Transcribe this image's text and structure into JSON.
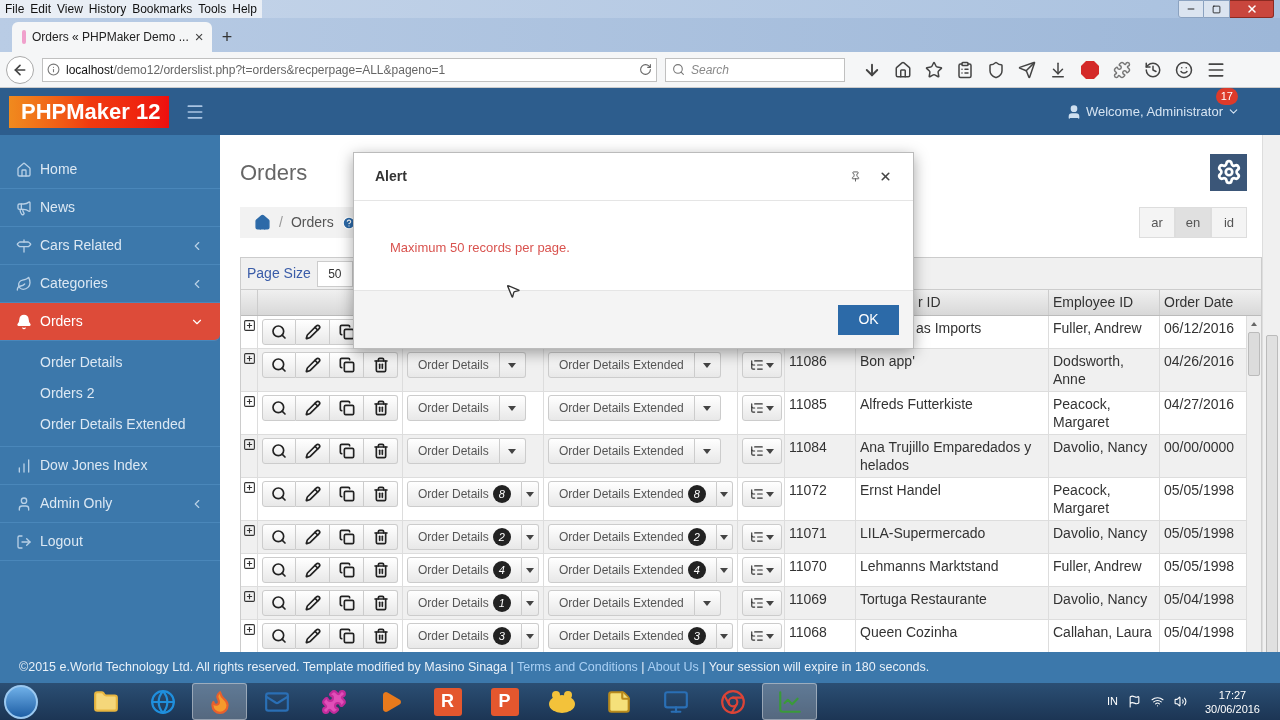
{
  "browser": {
    "menu": [
      "File",
      "Edit",
      "View",
      "History",
      "Bookmarks",
      "Tools",
      "Help"
    ],
    "tab": {
      "title": "Orders « PHPMaker Demo ...",
      "close": "×"
    },
    "new_tab": "+",
    "url": {
      "host": "localhost",
      "path": "/demo12/orderslist.php?t=orders&recperpage=ALL&pageno=1"
    },
    "search": {
      "placeholder": "Search"
    }
  },
  "app": {
    "logo": "PHPMaker 12",
    "user": "Welcome, Administrator",
    "notifications": "17"
  },
  "sidebar": {
    "items": [
      {
        "label": "Home",
        "selected": false
      },
      {
        "label": "News",
        "selected": false
      },
      {
        "label": "Cars Related",
        "selected": false,
        "expanded": false
      },
      {
        "label": "Categories",
        "selected": false,
        "expanded": false
      },
      {
        "label": "Orders",
        "selected": true,
        "expanded": true,
        "children": [
          {
            "label": "Order Details"
          },
          {
            "label": "Orders 2"
          },
          {
            "label": "Order Details Extended"
          }
        ]
      },
      {
        "label": "Dow Jones Index",
        "selected": false
      },
      {
        "label": "Admin Only",
        "selected": false,
        "expanded": false
      },
      {
        "label": "Logout",
        "selected": false
      }
    ]
  },
  "page": {
    "title": "Orders",
    "breadcrumb_separator": "/",
    "breadcrumb": "Orders",
    "languages": [
      {
        "label": "ar",
        "selected": false
      },
      {
        "label": "en",
        "selected": true
      },
      {
        "label": "id",
        "selected": false
      }
    ]
  },
  "table": {
    "page_size_label": "Page Size",
    "page_size": "50",
    "columns": [
      {
        "label": "r ID",
        "covered": true
      },
      {
        "label": "Employee ID",
        "covered": false
      },
      {
        "label": "Order Date",
        "covered": false
      }
    ],
    "rows": [
      {
        "covered": true,
        "customer": "as Imports",
        "employee": "Fuller, Andrew",
        "date": "06/12/2016"
      },
      {
        "covered": false,
        "details": "Order Details",
        "details_extended": "Order Details Extended",
        "order_id": "11086",
        "customer": "Bon app'",
        "employee": "Dodsworth, Anne",
        "date": "04/26/2016"
      },
      {
        "covered": false,
        "details": "Order Details",
        "details_extended": "Order Details Extended",
        "order_id": "11085",
        "customer": "Alfreds Futterkiste",
        "employee": "Peacock, Margaret",
        "date": "04/27/2016"
      },
      {
        "covered": false,
        "details": "Order Details",
        "details_extended": "Order Details Extended",
        "order_id": "11084",
        "customer": "Ana Trujillo Emparedados y helados",
        "employee": "Davolio, Nancy",
        "date": "00/00/0000"
      },
      {
        "covered": false,
        "details": "Order Details",
        "details_count": "8",
        "details_extended": "Order Details Extended",
        "details_extended_count": "8",
        "order_id": "11072",
        "customer": "Ernst Handel",
        "employee": "Peacock, Margaret",
        "date": "05/05/1998"
      },
      {
        "covered": false,
        "details": "Order Details",
        "details_count": "2",
        "details_extended": "Order Details Extended",
        "details_extended_count": "2",
        "order_id": "11071",
        "customer": "LILA-Supermercado",
        "employee": "Davolio, Nancy",
        "date": "05/05/1998"
      },
      {
        "covered": false,
        "details": "Order Details",
        "details_count": "4",
        "details_extended": "Order Details Extended",
        "details_extended_count": "4",
        "order_id": "11070",
        "customer": "Lehmanns Marktstand",
        "employee": "Fuller, Andrew",
        "date": "05/05/1998"
      },
      {
        "covered": false,
        "details": "Order Details",
        "details_count": "1",
        "details_extended": "Order Details Extended",
        "order_id": "11069",
        "customer": "Tortuga Restaurante",
        "employee": "Davolio, Nancy",
        "date": "05/04/1998"
      },
      {
        "covered": false,
        "details": "Order Details",
        "details_count": "3",
        "details_extended": "Order Details Extended",
        "details_extended_count": "3",
        "order_id": "11068",
        "customer": "Queen Cozinha",
        "employee": "Callahan, Laura",
        "date": "05/04/1998"
      }
    ]
  },
  "alert": {
    "title": "Alert",
    "message": "Maximum 50 records per page.",
    "button": "OK"
  },
  "footer": {
    "parts": [
      {
        "kind": "text",
        "text": "©2015 e.World Technology Ltd. All rights reserved. Template modified by Masino Sinaga |"
      },
      {
        "kind": "link",
        "text": "Terms and Conditions"
      },
      {
        "kind": "text",
        "text": "|"
      },
      {
        "kind": "link",
        "text": "About Us"
      },
      {
        "kind": "text",
        "text": "| Your session will expire in 180 seconds."
      }
    ]
  },
  "taskbar": {
    "apps": [
      {
        "kind": "folder",
        "selected": false
      },
      {
        "kind": "ie",
        "selected": false
      },
      {
        "kind": "firefox",
        "selected": true
      },
      {
        "kind": "mail",
        "selected": false
      },
      {
        "kind": "purple",
        "selected": false
      },
      {
        "kind": "media",
        "selected": false
      },
      {
        "kind": "letter",
        "label": "R",
        "selected": false
      },
      {
        "kind": "letter",
        "label": "P",
        "selected": false
      },
      {
        "kind": "creature",
        "selected": false
      },
      {
        "kind": "note",
        "selected": false
      },
      {
        "kind": "remote",
        "selected": false
      },
      {
        "kind": "chrome",
        "selected": false
      },
      {
        "kind": "chart",
        "selected": true
      }
    ],
    "language": "IN",
    "time": "17:27",
    "date": "30/06/2016"
  }
}
